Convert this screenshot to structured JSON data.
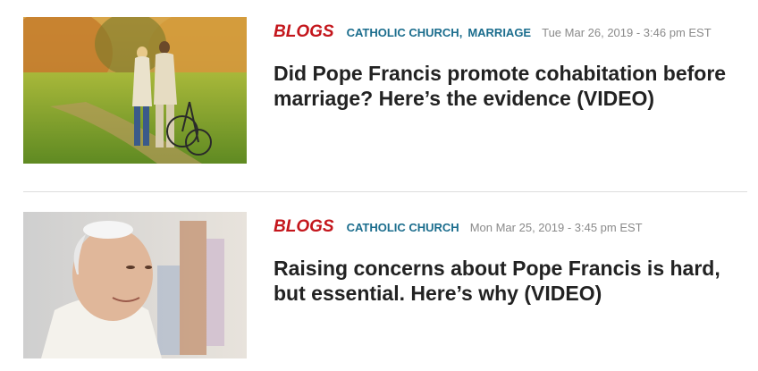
{
  "articles": [
    {
      "category": "BLOGS",
      "tags": [
        "CATHOLIC CHURCH",
        "MARRIAGE"
      ],
      "date": "Tue Mar 26, 2019 - 3:46 pm EST",
      "headline": "Did Pope Francis promote cohabitation before marriage? Here’s the evidence (VIDEO)"
    },
    {
      "category": "BLOGS",
      "tags": [
        "CATHOLIC CHURCH"
      ],
      "date": "Mon Mar 25, 2019 - 3:45 pm EST",
      "headline": "Raising concerns about Pope Francis is hard, but essential. Here’s why (VIDEO)"
    }
  ],
  "colors": {
    "category": "#c4161c",
    "tag": "#1b6d8d",
    "date": "#8a8a8a",
    "headline": "#222222",
    "divider": "#dddddd"
  }
}
